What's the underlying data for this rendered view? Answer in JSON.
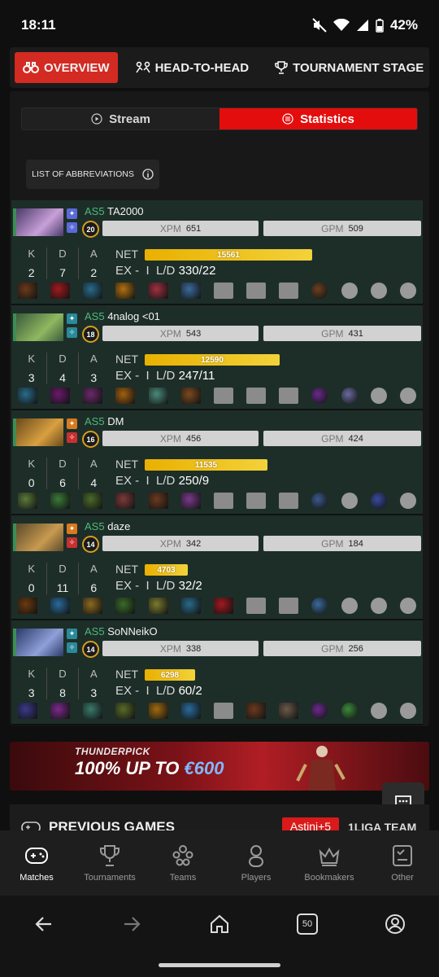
{
  "status_bar": {
    "time": "18:11",
    "battery": "42%"
  },
  "top_tabs": [
    {
      "label": "OVERVIEW",
      "active": true
    },
    {
      "label": "HEAD-TO-HEAD",
      "active": false
    },
    {
      "label": "TOURNAMENT STAGE",
      "active": false
    }
  ],
  "switch": {
    "stream": "Stream",
    "statistics": "Statistics"
  },
  "abbreviations_label": "LIST OF ABBREVIATIONS",
  "labels": {
    "xpm": "XPM",
    "gpm": "GPM",
    "k": "K",
    "d": "D",
    "a": "A",
    "net": "NET",
    "ex": "EX -",
    "sep": "I",
    "ld": "L/D"
  },
  "players": [
    {
      "team": "AS5",
      "name": "TA2000",
      "level": "20",
      "xpm": "651",
      "gpm": "509",
      "k": "2",
      "d": "7",
      "a": "2",
      "net": "15561",
      "ld": "330/22",
      "net_fraction": 0.86
    },
    {
      "team": "AS5",
      "name": "4nalog <01",
      "level": "18",
      "xpm": "543",
      "gpm": "431",
      "k": "3",
      "d": "4",
      "a": "3",
      "net": "12590",
      "ld": "247/11",
      "net_fraction": 0.69
    },
    {
      "team": "AS5",
      "name": "DM",
      "level": "16",
      "xpm": "456",
      "gpm": "424",
      "k": "0",
      "d": "6",
      "a": "4",
      "net": "11535",
      "ld": "250/9",
      "net_fraction": 0.63
    },
    {
      "team": "AS5",
      "name": "daze",
      "level": "14",
      "xpm": "342",
      "gpm": "184",
      "k": "0",
      "d": "11",
      "a": "6",
      "net": "4703",
      "ld": "32/2",
      "net_fraction": 0.22
    },
    {
      "team": "AS5",
      "name": "SoNNeikO",
      "level": "14",
      "xpm": "338",
      "gpm": "256",
      "k": "3",
      "d": "8",
      "a": "3",
      "net": "6298",
      "ld": "60/2",
      "net_fraction": 0.26
    }
  ],
  "ad": {
    "brand": "THUNDERPICK",
    "text_prefix": "100% UP TO ",
    "text_highlight": "€600"
  },
  "previous_games": {
    "title": "PREVIOUS GAMES",
    "badge": "Astini+5",
    "right_text": "1LIGA TEAM"
  },
  "bottom_nav": [
    {
      "label": "Matches",
      "icon": "gamepad-icon",
      "active": true
    },
    {
      "label": "Tournaments",
      "icon": "trophy-icon",
      "active": false
    },
    {
      "label": "Teams",
      "icon": "team-icon",
      "active": false
    },
    {
      "label": "Players",
      "icon": "player-icon",
      "active": false
    },
    {
      "label": "Bookmakers",
      "icon": "crown-icon",
      "active": false
    },
    {
      "label": "Other",
      "icon": "other-icon",
      "active": false
    }
  ],
  "system_nav": {
    "tabs_count": "50"
  },
  "colors": {
    "accent": "#d32a22",
    "statistics_active": "#e40d0d",
    "team_green": "#4fb87a",
    "net_gold": "#e9b000"
  }
}
